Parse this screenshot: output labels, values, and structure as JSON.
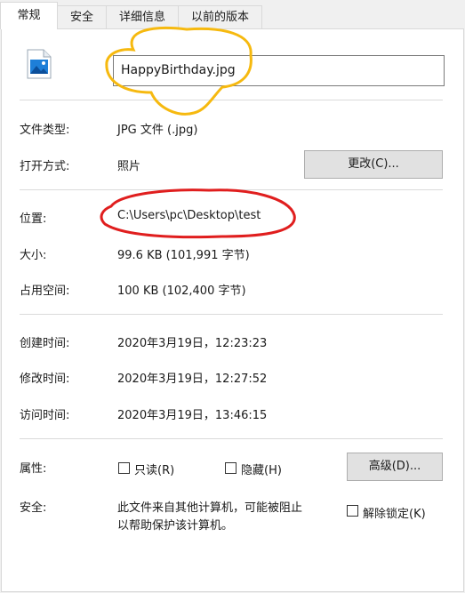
{
  "tabs": [
    "常规",
    "安全",
    "详细信息",
    "以前的版本"
  ],
  "file": {
    "icon": "image-file-icon",
    "name": "HappyBirthday.jpg"
  },
  "info": {
    "type_label": "文件类型:",
    "type_value": "JPG 文件 (.jpg)",
    "open_label": "打开方式:",
    "open_value": "照片",
    "change_button": "更改(C)...",
    "location_label": "位置:",
    "location_value": "C:\\Users\\pc\\Desktop\\test",
    "size_label": "大小:",
    "size_value": "99.6 KB (101,991 字节)",
    "disk_label": "占用空间:",
    "disk_value": "100 KB (102,400 字节)",
    "created_label": "创建时间:",
    "created_value": "2020年3月19日，12:23:23",
    "modified_label": "修改时间:",
    "modified_value": "2020年3月19日，12:27:52",
    "accessed_label": "访问时间:",
    "accessed_value": "2020年3月19日，13:46:15"
  },
  "attributes": {
    "label": "属性:",
    "readonly": "只读(R)",
    "readonly_checked": false,
    "hidden": "隐藏(H)",
    "hidden_checked": false,
    "advanced_button": "高级(D)..."
  },
  "security": {
    "label": "安全:",
    "text_line1": "此文件来自其他计算机，可能被阻止",
    "text_line2": "以帮助保护该计算机。",
    "unblock": "解除锁定(K)",
    "unblock_checked": false
  },
  "colors": {
    "annotation_yellow": "#f6b90f",
    "annotation_red": "#e01e1e"
  }
}
